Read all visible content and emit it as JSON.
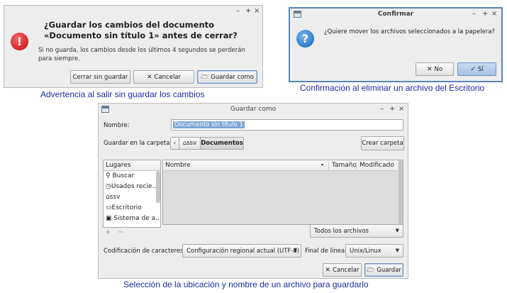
{
  "dialog1": {
    "message": "¿Guardar los cambios del documento «Documento sin título 1» antes de cerrar?",
    "detail": "Si no guarda, los cambios desde los últimos 4 segundos se perderán para siempre.",
    "buttons": {
      "close_without_saving": "Cerrar sin guardar",
      "cancel": "Cancelar",
      "save_as": "Guardar como"
    },
    "caption": "Advertencia al salir sin guardar los cambios"
  },
  "dialog2": {
    "title": "Confirmar",
    "message": "¿Quiere mover los archivos seleccionados a la papelera?",
    "buttons": {
      "no": "No",
      "yes": "Sí"
    },
    "caption": "Confirmación al eliminar un archivo del Escritorio"
  },
  "dialog3": {
    "title": "Guardar como",
    "name_label": "Nombre:",
    "name_value": "Documento sin título 1",
    "folder_label": "Guardar en la carpeta:",
    "path": [
      "ssv",
      "Documentos"
    ],
    "create_folder": "Crear carpeta",
    "places_header": "Lugares",
    "places": [
      "Buscar",
      "Usados recie…",
      "ssv",
      "Escritorio",
      "Sistema de a…"
    ],
    "columns": {
      "name": "Nombre",
      "size": "Tamaño",
      "modified": "Modificado"
    },
    "file_filter": "Todos los archivos",
    "encoding_label": "Codificación de caracteres:",
    "encoding_value": "Configuración regional actual (UTF-8)",
    "line_end_label": "Final de línea:",
    "line_end_value": "Unix/Linux",
    "buttons": {
      "cancel": "Cancelar",
      "save": "Guardar"
    },
    "caption": "Selección de la ubicación y nombre de un archivo para guardarlo"
  },
  "window_controls": {
    "minimize": "–",
    "maximize": "+",
    "close": "×"
  },
  "colors": {
    "error_red": "#d8262a",
    "question_blue": "#2e7fcf",
    "selection_blue": "#7ea6d6",
    "caption_blue": "#1f2aa6"
  }
}
